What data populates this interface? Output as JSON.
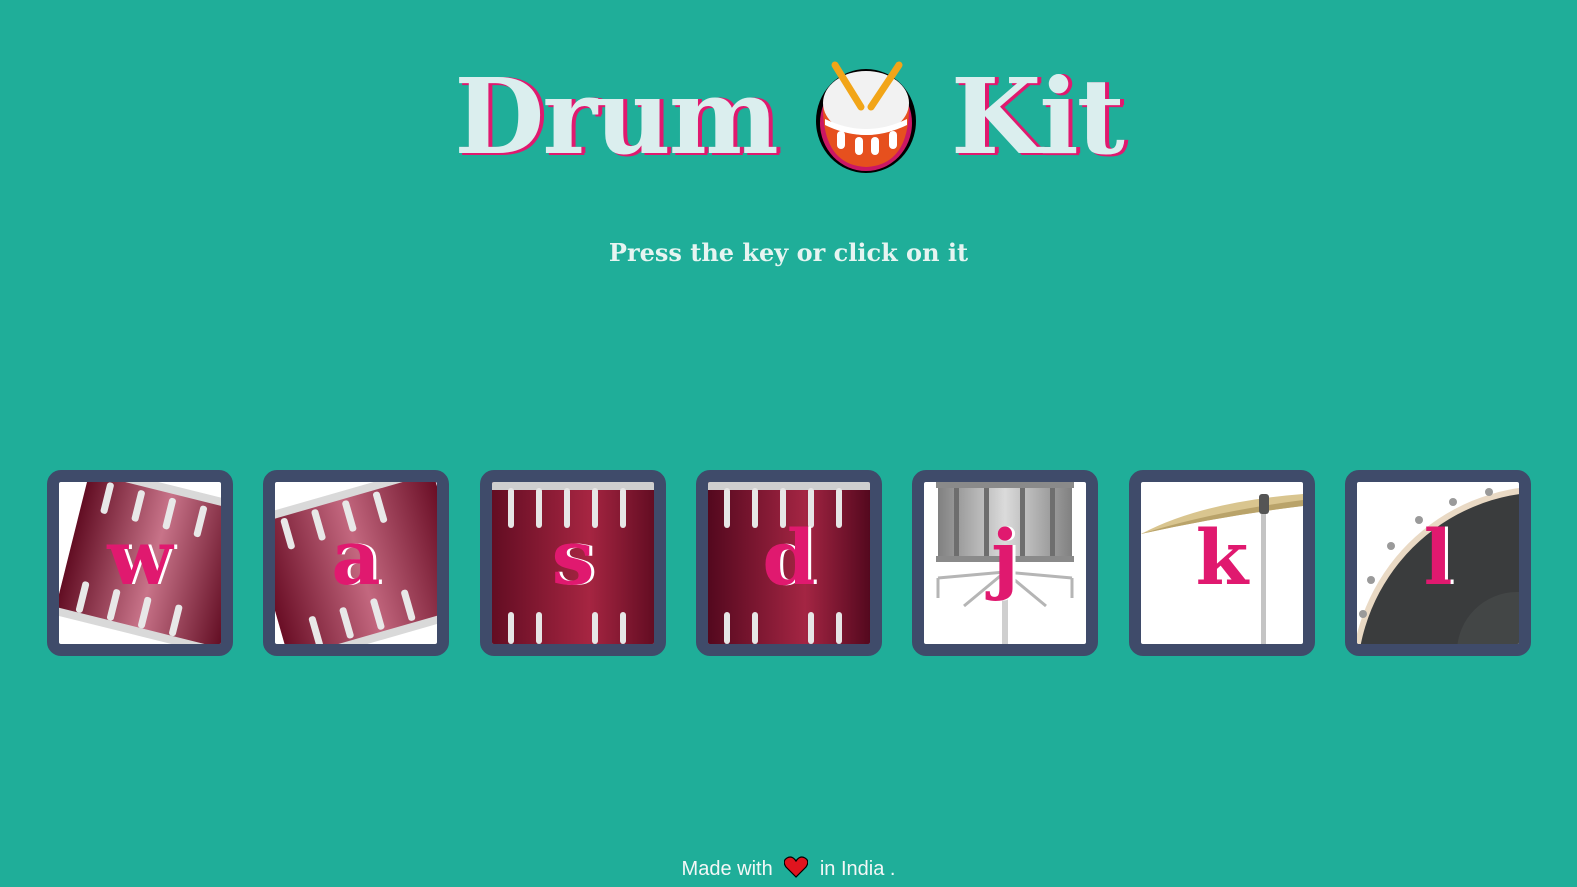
{
  "header": {
    "title_left": "Drum",
    "title_right": "Kit",
    "title_icon": "drum-emoji-icon",
    "subtitle": "Press the key or click on it"
  },
  "drums": [
    {
      "key": "w",
      "image": "tom-1-icon"
    },
    {
      "key": "a",
      "image": "tom-2-icon"
    },
    {
      "key": "s",
      "image": "tom-3-icon"
    },
    {
      "key": "d",
      "image": "tom-4-icon"
    },
    {
      "key": "j",
      "image": "snare-icon"
    },
    {
      "key": "k",
      "image": "crash-cymbal-icon"
    },
    {
      "key": "l",
      "image": "kick-drum-icon"
    }
  ],
  "footer": {
    "prefix": "Made with",
    "icon": "heart-icon",
    "suffix": "in India ."
  },
  "colors": {
    "background": "#1fae99",
    "button_border": "#3f4b6a",
    "accent": "#e0196f",
    "drum_red": "#a3163a"
  }
}
